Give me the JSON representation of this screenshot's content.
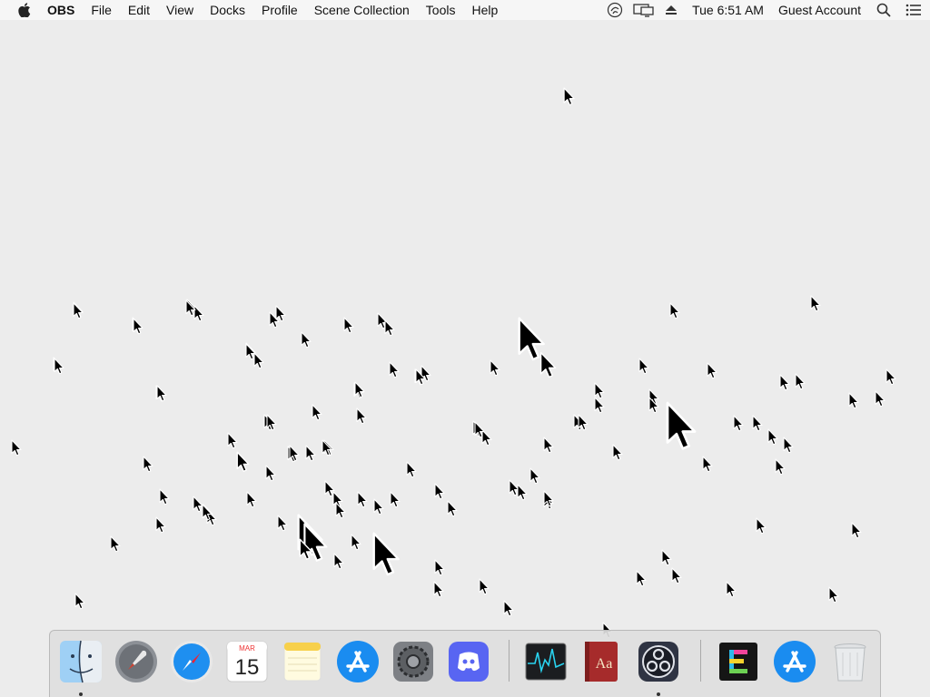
{
  "menubar": {
    "app_name": "OBS",
    "items": [
      "File",
      "Edit",
      "View",
      "Docks",
      "Profile",
      "Scene Collection",
      "Tools",
      "Help"
    ],
    "clock": "Tue 6:51 AM",
    "user": "Guest Account",
    "status_icons": [
      "obs-status-icon",
      "display-mirroring-icon",
      "eject-icon",
      "spotlight-search-icon",
      "notification-center-icon"
    ]
  },
  "dock": {
    "apps": [
      {
        "name": "Finder",
        "icon": "finder-icon",
        "running": true
      },
      {
        "name": "Launchpad",
        "icon": "launchpad-icon",
        "running": false
      },
      {
        "name": "Safari",
        "icon": "safari-icon",
        "running": false
      },
      {
        "name": "Calendar",
        "icon": "calendar-icon",
        "running": false,
        "month": "MAR",
        "day": "15"
      },
      {
        "name": "Notes",
        "icon": "notes-icon",
        "running": false
      },
      {
        "name": "App Store",
        "icon": "app-store-icon",
        "running": false
      },
      {
        "name": "System Preferences",
        "icon": "system-preferences-icon",
        "running": false
      },
      {
        "name": "Discord",
        "icon": "discord-icon",
        "running": false
      },
      {
        "name": "Activity Monitor",
        "icon": "activity-monitor-icon",
        "running": false
      },
      {
        "name": "Dictionary",
        "icon": "dictionary-icon",
        "running": false,
        "label": "Aa"
      },
      {
        "name": "OBS",
        "icon": "obs-icon",
        "running": true
      },
      {
        "name": "Emacs",
        "icon": "emacs-icon",
        "running": false
      },
      {
        "name": "App Store (recent)",
        "icon": "app-store-recent-icon",
        "running": false
      },
      {
        "name": "Trash",
        "icon": "trash-icon",
        "running": false
      }
    ]
  },
  "cursor_count": 118
}
